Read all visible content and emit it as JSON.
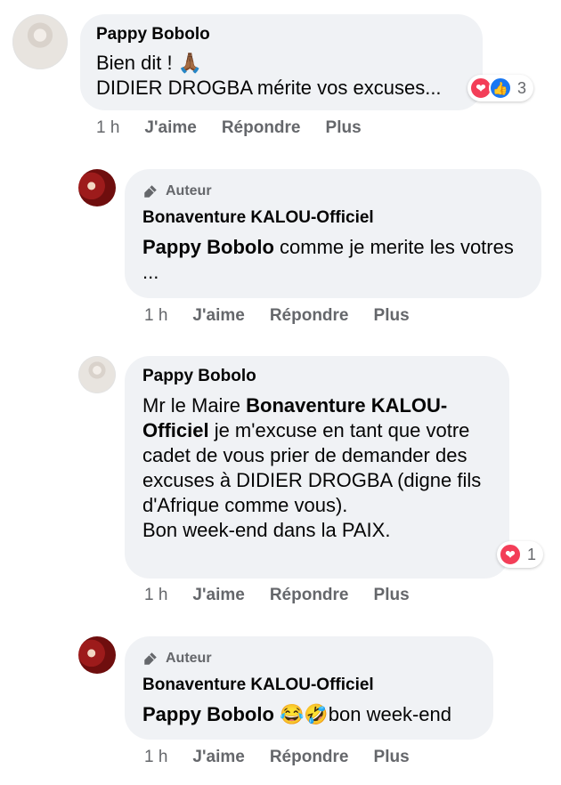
{
  "comments": [
    {
      "name": "Pappy Bobolo",
      "line1": "Bien dit ! 🙏🏾",
      "line2": "DIDIER DROGBA mérite vos excuses...",
      "reaction_count": "3",
      "time": "1 h",
      "like": "J'aime",
      "reply": "Répondre",
      "more": "Plus"
    },
    {
      "badge": "Auteur",
      "name": "Bonaventure KALOU-Officiel",
      "mention": "Pappy Bobolo",
      "text": " comme je merite les votres ...",
      "time": "1 h",
      "like": "J'aime",
      "reply": "Répondre",
      "more": "Plus"
    },
    {
      "name": "Pappy Bobolo",
      "prefix": "Mr le Maire ",
      "mention": "Bonaventure KALOU-Officiel",
      "text": " je m'excuse en tant que votre cadet de vous prier de demander des excuses à DIDIER DROGBA (digne fils d'Afrique comme vous).",
      "line_end": "Bon week-end dans la PAIX.",
      "reaction_count": "1",
      "time": "1 h",
      "like": "J'aime",
      "reply": "Répondre",
      "more": "Plus"
    },
    {
      "badge": "Auteur",
      "name": "Bonaventure KALOU-Officiel",
      "mention": "Pappy Bobolo",
      "text": " 😂🤣bon week-end",
      "time": "1 h",
      "like": "J'aime",
      "reply": "Répondre",
      "more": "Plus"
    }
  ],
  "colors": {
    "bubble": "#f0f2f5",
    "meta": "#65676b",
    "text": "#050505",
    "love": "#f33e58",
    "like": "#1877f2"
  }
}
